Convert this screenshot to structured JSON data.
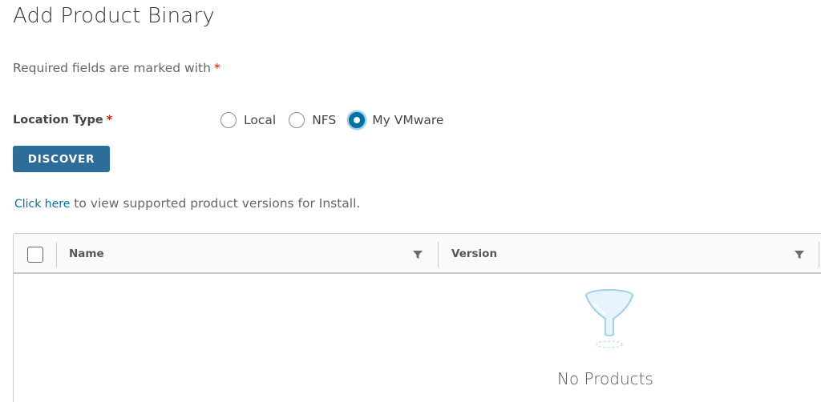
{
  "page": {
    "title": "Add Product Binary",
    "required_note": "Required fields are marked with",
    "required_marker": "*"
  },
  "location_type": {
    "label": "Location Type",
    "required_marker": "*",
    "options": [
      {
        "label": "Local",
        "selected": false
      },
      {
        "label": "NFS",
        "selected": false
      },
      {
        "label": "My VMware",
        "selected": true
      }
    ]
  },
  "discover_button": {
    "label": "DISCOVER"
  },
  "info": {
    "link_text": "Click here",
    "rest_text": " to view supported product versions for Install."
  },
  "grid": {
    "columns": [
      {
        "title": "Name"
      },
      {
        "title": "Version"
      }
    ],
    "empty_text": "No Products"
  },
  "colors": {
    "primary": "#0072a3",
    "required": "#c92100",
    "border": "#cccccc"
  },
  "icons": {
    "filter": "filter-icon",
    "empty": "funnel-empty-icon"
  }
}
